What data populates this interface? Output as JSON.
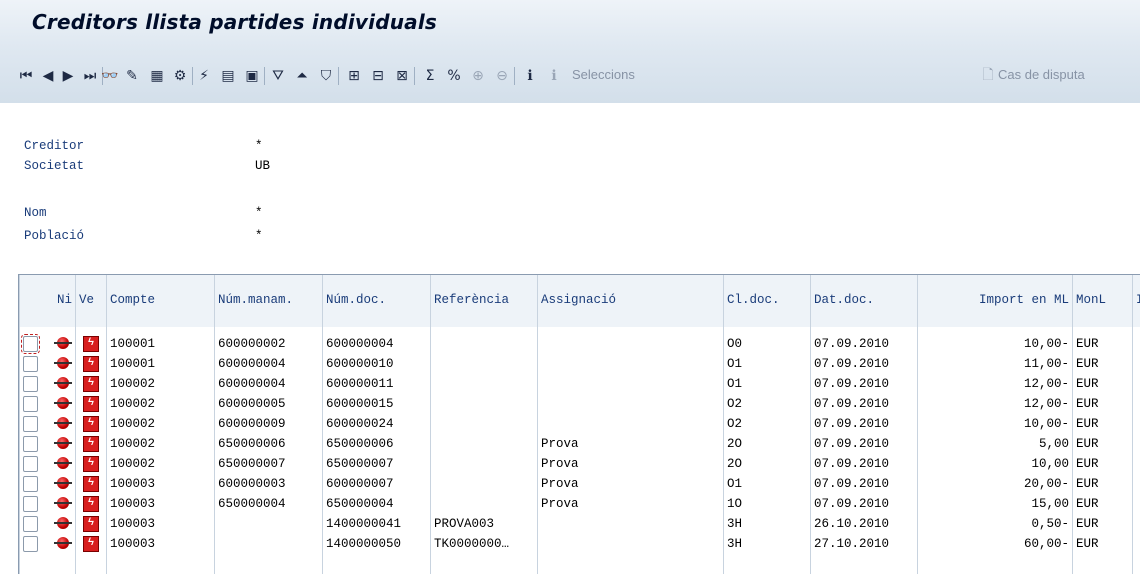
{
  "window": {
    "title": "Creditors llista partides individuals"
  },
  "toolbar": {
    "buttons": [
      {
        "name": "first-page-icon",
        "glyph": "⏮",
        "disabled": false
      },
      {
        "name": "prev-page-icon",
        "glyph": "◀",
        "disabled": false
      },
      {
        "name": "next-page-icon",
        "glyph": "▶",
        "disabled": false
      },
      {
        "name": "last-page-icon",
        "glyph": "⏭",
        "disabled": false
      },
      {
        "name": "display-icon",
        "glyph": "👓",
        "disabled": false
      },
      {
        "name": "change-icon",
        "glyph": "✎",
        "disabled": false
      },
      {
        "name": "select-layout-icon",
        "glyph": "▦",
        "disabled": false
      },
      {
        "name": "mass-change-icon",
        "glyph": "⚙",
        "disabled": false
      },
      {
        "name": "overview-icon",
        "glyph": "⚡",
        "disabled": false
      },
      {
        "name": "document-icon",
        "glyph": "▤",
        "disabled": false
      },
      {
        "name": "detail-icon",
        "glyph": "▣",
        "disabled": false
      },
      {
        "name": "filter-icon",
        "glyph": "⛛",
        "disabled": false
      },
      {
        "name": "sort-ascending-icon",
        "glyph": "⏶",
        "disabled": false
      },
      {
        "name": "set-filter-icon",
        "glyph": "⛉",
        "disabled": false
      },
      {
        "name": "change-layout-icon",
        "glyph": "⊞",
        "disabled": false
      },
      {
        "name": "select-columns-icon",
        "glyph": "⊟",
        "disabled": false
      },
      {
        "name": "save-layout-icon",
        "glyph": "⊠",
        "disabled": false
      },
      {
        "name": "sum-icon",
        "glyph": "Σ",
        "disabled": false
      },
      {
        "name": "subtotal-icon",
        "glyph": "%",
        "disabled": false
      },
      {
        "name": "expand-icon",
        "glyph": "⊕",
        "disabled": true
      },
      {
        "name": "collapse-icon",
        "glyph": "⊖",
        "disabled": true
      },
      {
        "name": "info-icon",
        "glyph": "ℹ",
        "disabled": false
      },
      {
        "name": "selections-info-icon",
        "glyph": "ℹ",
        "disabled": true
      }
    ],
    "selections_label": "Seleccions",
    "dispute_label": "Cas de disputa"
  },
  "header_info": {
    "creditor_label": "Creditor",
    "creditor_value": "*",
    "company_label": "Societat",
    "company_value": "UB",
    "name_label": "Nom",
    "name_value": "*",
    "city_label": "Població",
    "city_value": "*"
  },
  "table": {
    "columns": [
      "Ni",
      "Ve",
      "Compte",
      "Núm.manam.",
      "Núm.doc.",
      "Referència",
      "Assignació",
      "Cl.doc.",
      "Dat.doc.",
      "Import en ML",
      "MonL",
      "I"
    ],
    "rows": [
      {
        "account": "100001",
        "mandate": "600000002",
        "doc": "600000004",
        "reference": "",
        "assignment": "",
        "doc_type": "O0",
        "doc_date": "07.09.2010",
        "amount": "10,00-",
        "currency": "EUR"
      },
      {
        "account": "100001",
        "mandate": "600000004",
        "doc": "600000010",
        "reference": "",
        "assignment": "",
        "doc_type": "O1",
        "doc_date": "07.09.2010",
        "amount": "11,00-",
        "currency": "EUR"
      },
      {
        "account": "100002",
        "mandate": "600000004",
        "doc": "600000011",
        "reference": "",
        "assignment": "",
        "doc_type": "O1",
        "doc_date": "07.09.2010",
        "amount": "12,00-",
        "currency": "EUR"
      },
      {
        "account": "100002",
        "mandate": "600000005",
        "doc": "600000015",
        "reference": "",
        "assignment": "",
        "doc_type": "O2",
        "doc_date": "07.09.2010",
        "amount": "12,00-",
        "currency": "EUR"
      },
      {
        "account": "100002",
        "mandate": "600000009",
        "doc": "600000024",
        "reference": "",
        "assignment": "",
        "doc_type": "O2",
        "doc_date": "07.09.2010",
        "amount": "10,00-",
        "currency": "EUR"
      },
      {
        "account": "100002",
        "mandate": "650000006",
        "doc": "650000006",
        "reference": "",
        "assignment": "Prova",
        "doc_type": "2O",
        "doc_date": "07.09.2010",
        "amount": "5,00",
        "currency": "EUR"
      },
      {
        "account": "100002",
        "mandate": "650000007",
        "doc": "650000007",
        "reference": "",
        "assignment": "Prova",
        "doc_type": "2O",
        "doc_date": "07.09.2010",
        "amount": "10,00",
        "currency": "EUR"
      },
      {
        "account": "100003",
        "mandate": "600000003",
        "doc": "600000007",
        "reference": "",
        "assignment": "Prova",
        "doc_type": "O1",
        "doc_date": "07.09.2010",
        "amount": "20,00-",
        "currency": "EUR"
      },
      {
        "account": "100003",
        "mandate": "650000004",
        "doc": "650000004",
        "reference": "",
        "assignment": "Prova",
        "doc_type": "1O",
        "doc_date": "07.09.2010",
        "amount": "15,00",
        "currency": "EUR"
      },
      {
        "account": "100003",
        "mandate": "",
        "doc": "1400000041",
        "reference": "PROVA003",
        "assignment": "",
        "doc_type": "3H",
        "doc_date": "26.10.2010",
        "amount": "0,50-",
        "currency": "EUR"
      },
      {
        "account": "100003",
        "mandate": "",
        "doc": "1400000050",
        "reference": "TK0000000…",
        "assignment": "",
        "doc_type": "3H",
        "doc_date": "27.10.2010",
        "amount": "60,00-",
        "currency": "EUR"
      }
    ]
  }
}
